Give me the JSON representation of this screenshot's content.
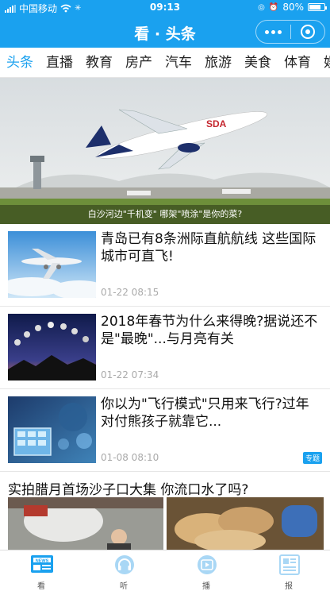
{
  "status_bar": {
    "carrier": "中国移动",
    "time": "09:13",
    "battery": "80%",
    "battery_level": 0.8
  },
  "navbar": {
    "title": "看 · 头条"
  },
  "tabs": [
    "头条",
    "直播",
    "教育",
    "房产",
    "汽车",
    "旅游",
    "美食",
    "体育",
    "娱"
  ],
  "hero": {
    "caption": "白沙河边\"千机变\" 哪架\"喷涂\"是你的菜?"
  },
  "news": [
    {
      "headline": "青岛已有8条洲际直航航线 这些国际城市可直飞!",
      "time": "01-22 08:15"
    },
    {
      "headline": "2018年春节为什么来得晚?据说还不是\"最晚\"...与月亮有关",
      "time": "01-22 07:34"
    },
    {
      "headline": "你以为\"飞行模式\"只用来飞行?过年对付熊孩子就靠它...",
      "time": "01-08 08:10",
      "badge": "专题"
    }
  ],
  "feature": {
    "headline": "实拍腊月首场沙子口大集 你流口水了吗?"
  },
  "tabbar": [
    {
      "label": "看",
      "icon": "news-icon",
      "active": true
    },
    {
      "label": "听",
      "icon": "headphones-icon",
      "active": false
    },
    {
      "label": "播",
      "icon": "play-icon",
      "active": false
    },
    {
      "label": "报",
      "icon": "newspaper-icon",
      "active": false
    }
  ],
  "colors": {
    "accent": "#1aa1ef"
  }
}
